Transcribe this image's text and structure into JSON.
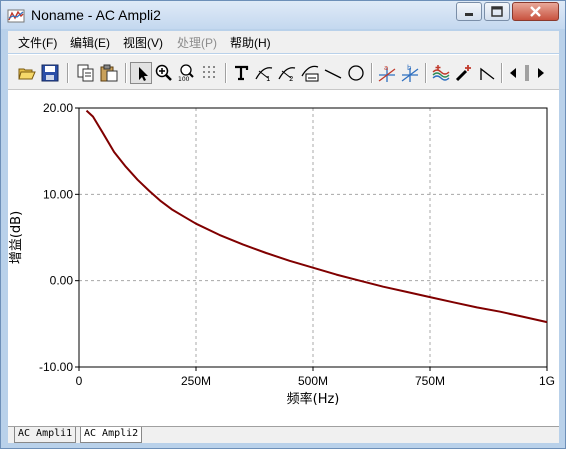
{
  "window": {
    "title": "Noname - AC Ampli2",
    "title_icon": "ac-ampli-app-icon"
  },
  "window_controls": [
    "minimize-icon",
    "maximize-icon",
    "close-icon"
  ],
  "menu": [
    {
      "label": "文件(F)",
      "enabled": true
    },
    {
      "label": "编辑(E)",
      "enabled": true
    },
    {
      "label": "视图(V)",
      "enabled": true
    },
    {
      "label": "处理(P)",
      "enabled": false
    },
    {
      "label": "帮助(H)",
      "enabled": true
    }
  ],
  "toolbar": {
    "buttons": [
      "open-icon",
      "save-icon",
      "copy-icon",
      "paste-icon",
      "pointer-icon",
      "zoom-in-icon",
      "zoom-100-icon",
      "grid-icon",
      "text-icon",
      "label-curve-1-icon",
      "label-curve-2-icon",
      "label-curve-3-icon",
      "line-icon",
      "ellipse-icon",
      "cursor-a-icon",
      "cursor-b-icon",
      "multi-trace-icon",
      "pick-color-icon",
      "step-icon",
      "scroll-left-icon",
      "scroll-right-icon"
    ],
    "selected": "pointer-icon"
  },
  "chart_data": {
    "type": "line",
    "title": "",
    "xlabel": "频率(Hz)",
    "ylabel": "增益(dB)",
    "x_unit": "Hz",
    "xlim": [
      0,
      1000000000
    ],
    "ylim": [
      -10,
      20
    ],
    "x_ticks": [
      {
        "value": 0,
        "label": "0"
      },
      {
        "value": 250000000,
        "label": "250M"
      },
      {
        "value": 500000000,
        "label": "500M"
      },
      {
        "value": 750000000,
        "label": "750M"
      },
      {
        "value": 1000000000,
        "label": "1G"
      }
    ],
    "y_ticks": [
      {
        "value": 20,
        "label": "20.00"
      },
      {
        "value": 10,
        "label": "10.00"
      },
      {
        "value": 0,
        "label": "0.00"
      },
      {
        "value": -10,
        "label": "-10.00"
      }
    ],
    "grid": true,
    "grid_style": "dashed",
    "series": [
      {
        "color": "#800000",
        "x": [
          16000000,
          30000000,
          50000000,
          75000000,
          100000000,
          125000000,
          150000000,
          175000000,
          200000000,
          225000000,
          250000000,
          300000000,
          350000000,
          400000000,
          450000000,
          500000000,
          550000000,
          600000000,
          650000000,
          700000000,
          750000000,
          800000000,
          850000000,
          900000000,
          950000000,
          1000000000
        ],
        "y": [
          19.7,
          19.0,
          17.2,
          14.9,
          13.2,
          11.7,
          10.4,
          9.2,
          8.2,
          7.4,
          6.6,
          5.3,
          4.2,
          3.2,
          2.3,
          1.5,
          0.7,
          0.0,
          -0.7,
          -1.3,
          -1.9,
          -2.5,
          -3.1,
          -3.6,
          -4.2,
          -4.8
        ]
      }
    ]
  },
  "tabs": [
    {
      "label": "AC Ampli1",
      "active": false
    },
    {
      "label": "AC Ampli2",
      "active": true
    }
  ]
}
